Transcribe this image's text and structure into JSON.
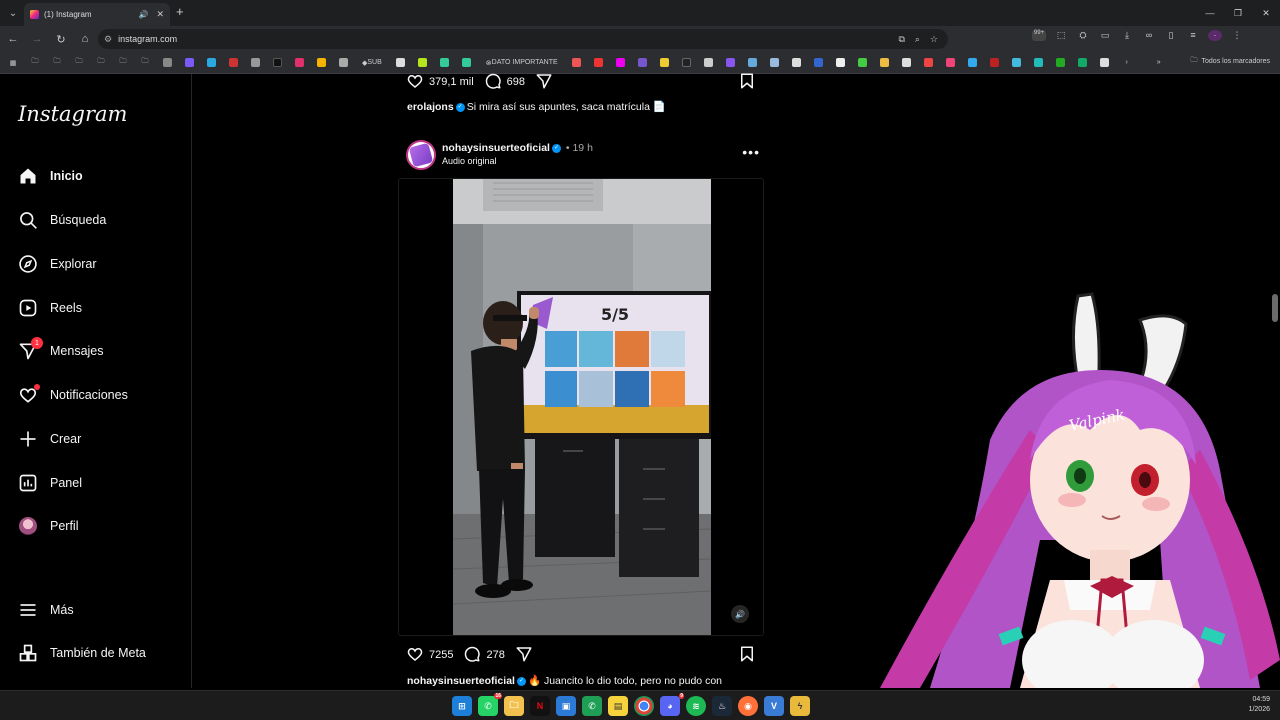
{
  "browser": {
    "tab_title": "(1) Instagram",
    "url": "instagram.com",
    "bookmarks_sub": "SUB",
    "bookmarks_dato": "DATO IMPORTANTE",
    "all_bookmarks": "Todos los marcadores",
    "downloads_badge": "99+"
  },
  "sidebar": {
    "logo": "Instagram",
    "items": [
      {
        "label": "Inicio",
        "icon": "home-icon"
      },
      {
        "label": "Búsqueda",
        "icon": "search-icon"
      },
      {
        "label": "Explorar",
        "icon": "compass-icon"
      },
      {
        "label": "Reels",
        "icon": "reels-icon"
      },
      {
        "label": "Mensajes",
        "icon": "messenger-icon",
        "badge": "1"
      },
      {
        "label": "Notificaciones",
        "icon": "heart-icon"
      },
      {
        "label": "Crear",
        "icon": "plus-icon"
      },
      {
        "label": "Panel",
        "icon": "dashboard-icon"
      },
      {
        "label": "Perfil",
        "icon": "avatar"
      },
      {
        "label": "Más",
        "icon": "menu-icon"
      },
      {
        "label": "También de Meta",
        "icon": "meta-apps-icon"
      }
    ]
  },
  "previous_post": {
    "likes": "379,1 mil",
    "comments": "698",
    "caption_user": "erolajons",
    "caption_text": "Si mira así sus apuntes, saca matrícula 📄"
  },
  "post": {
    "username": "nohaysinsuerteoficial",
    "time": "19 h",
    "audio": "Audio original",
    "screen_text": "5/5",
    "likes": "7255",
    "comments": "278",
    "caption_user": "nohaysinsuerteoficial",
    "caption_text": "🔥 Juancito lo dio todo, pero no pudo con"
  },
  "overlay": {
    "name_tag": "Valpink"
  },
  "taskbar": {
    "time": "04:59",
    "date": "1/2026"
  },
  "colors": {
    "badge": "#ff3040",
    "verified": "#0095f6",
    "background": "#000000"
  }
}
